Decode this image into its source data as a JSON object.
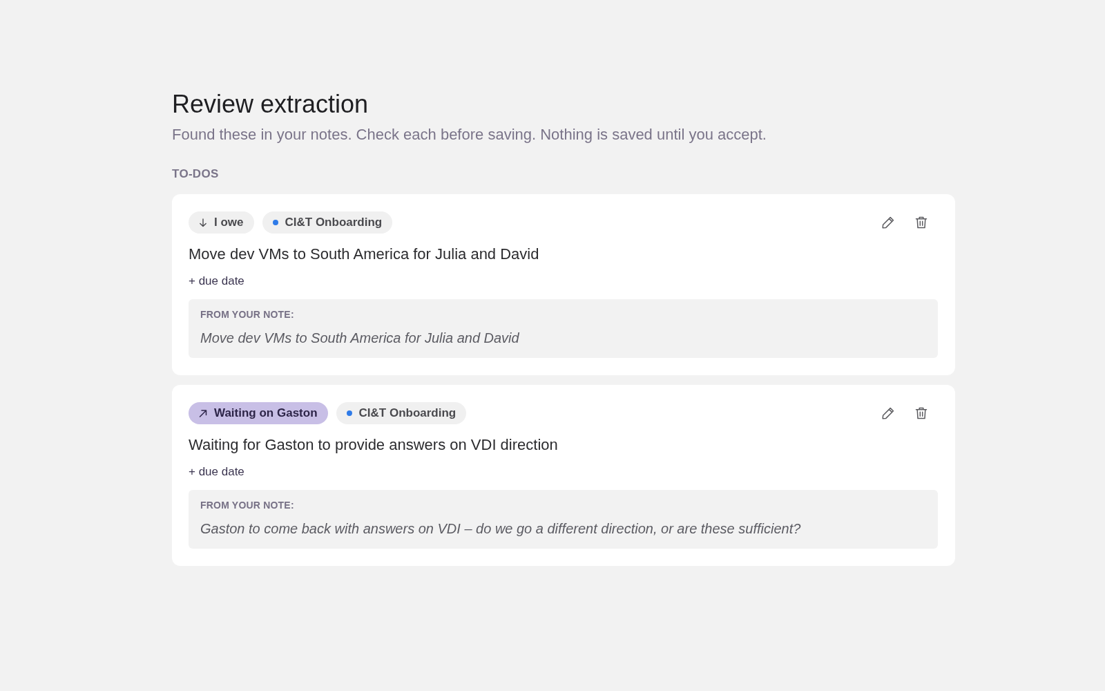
{
  "page": {
    "title": "Review extraction",
    "subtitle": "Found these in your notes. Check each before saving. Nothing is saved until you accept."
  },
  "section": {
    "heading": "TO-DOS"
  },
  "todos": [
    {
      "tags": [
        {
          "kind": "owe",
          "label": "I owe"
        },
        {
          "kind": "project",
          "label": "CI&T Onboarding",
          "color": "#2f7be8"
        }
      ],
      "title": "Move dev VMs to South America for Julia and David",
      "due_date": "+ due date",
      "note": {
        "label": "FROM YOUR NOTE:",
        "quote": "Move dev VMs to South America for Julia and David"
      }
    },
    {
      "tags": [
        {
          "kind": "waiting",
          "label": "Waiting on Gaston"
        },
        {
          "kind": "project",
          "label": "CI&T Onboarding",
          "color": "#2f7be8"
        }
      ],
      "title": "Waiting for Gaston to provide answers on VDI direction",
      "due_date": "+ due date",
      "note": {
        "label": "FROM YOUR NOTE:",
        "quote": "Gaston to come back with answers on VDI – do we go a different direction, or are these sufficient?"
      }
    }
  ]
}
